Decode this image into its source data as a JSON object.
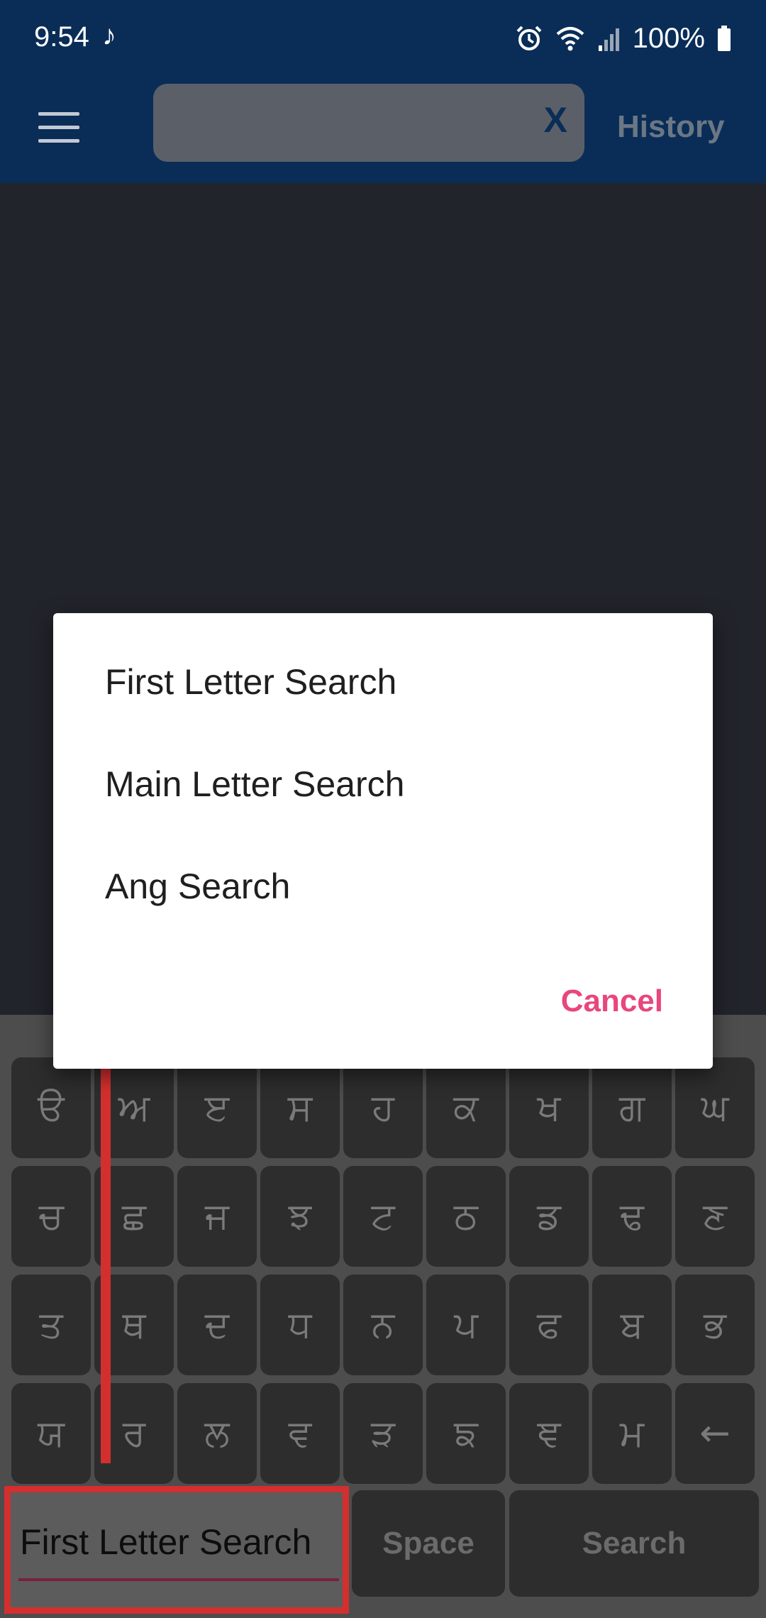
{
  "status_bar": {
    "time": "9:54",
    "music_icon": "♪",
    "battery": "100%"
  },
  "app_bar": {
    "search_value": "",
    "clear_label": "X",
    "history_label": "History"
  },
  "dialog": {
    "options": [
      "First Letter Search",
      "Main Letter Search",
      "Ang Search"
    ],
    "cancel_label": "Cancel"
  },
  "keyboard": {
    "rows": [
      [
        "ੳ",
        "ਅ",
        "ੲ",
        "ਸ",
        "ਹ",
        "ਕ",
        "ਖ",
        "ਗ",
        "ਘ"
      ],
      [
        "ਚ",
        "ਛ",
        "ਜ",
        "ਝ",
        "ਟ",
        "ਠ",
        "ਡ",
        "ਢ",
        "ਣ"
      ],
      [
        "ਤ",
        "ਥ",
        "ਦ",
        "ਧ",
        "ਨ",
        "ਪ",
        "ਫ",
        "ਬ",
        "ਭ"
      ],
      [
        "ਯ",
        "ਰ",
        "ਲ",
        "ਵ",
        "ੜ",
        "ਙ",
        "ਞ",
        "ਮ",
        "←"
      ]
    ],
    "mode_label": "First Letter Search",
    "space_label": "Space",
    "search_label": "Search"
  },
  "colors": {
    "app_bar": "#0a2d57",
    "background": "#22242b",
    "accent_cancel": "#e8467c",
    "highlight": "#d32f2f"
  },
  "icons": [
    "menu-icon",
    "music-note-icon",
    "alarm-icon",
    "wifi-icon",
    "signal-icon",
    "battery-icon",
    "backspace-icon"
  ]
}
